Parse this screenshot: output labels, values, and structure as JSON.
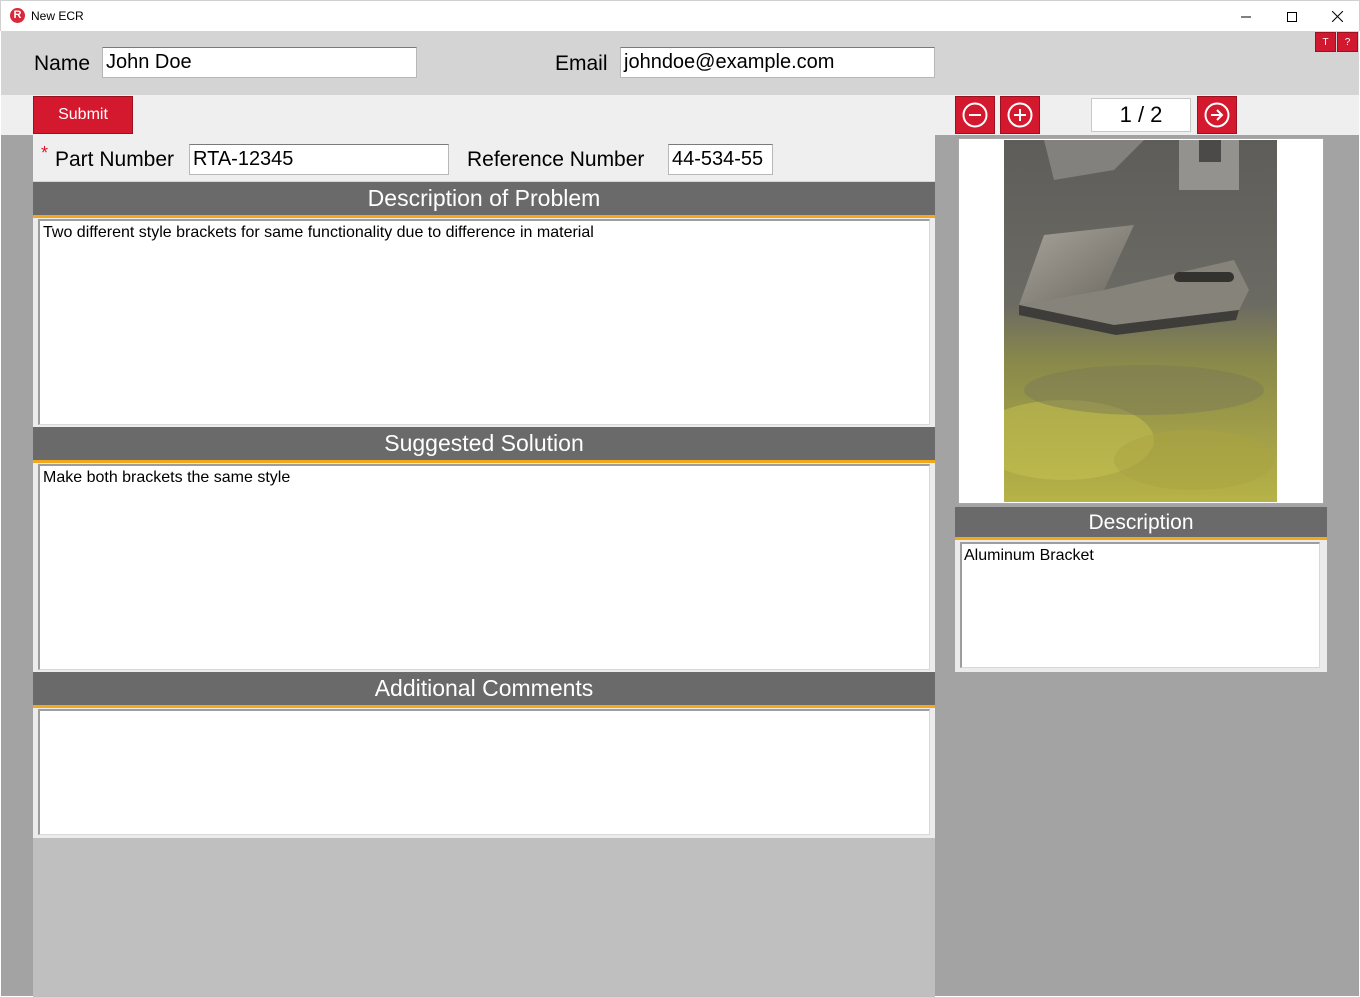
{
  "window": {
    "title": "New ECR",
    "app_icon_letter": "R",
    "controls": [
      "minimize-icon",
      "maximize-icon",
      "close-icon"
    ]
  },
  "header": {
    "name_label": "Name",
    "name_value": "John Doe",
    "email_label": "Email",
    "email_value": "johndoe@example.com",
    "t_button": "T",
    "help_button": "?"
  },
  "toolbar": {
    "submit_label": "Submit",
    "zoom_out_icon": "minus-circle-icon",
    "zoom_in_icon": "plus-circle-icon",
    "page_indicator": "1 / 2",
    "next_icon": "arrow-right-circle-icon"
  },
  "form": {
    "required_mark": "*",
    "part_number_label": "Part Number",
    "part_number_value": "RTA-12345",
    "reference_number_label": "Reference Number",
    "reference_number_value": "44-534-55",
    "sections": [
      {
        "title": "Description of Problem",
        "value": "Two different style brackets for same functionality due to difference in material"
      },
      {
        "title": "Suggested Solution",
        "value": "Make both brackets the same style"
      },
      {
        "title": "Additional Comments",
        "value": ""
      }
    ]
  },
  "image_panel": {
    "description_title": "Description",
    "description_value": "Aluminum Bracket"
  },
  "colors": {
    "accent_red": "#d4182e",
    "header_gray": "#6a6a6a",
    "underline_orange": "#f2a81d"
  }
}
